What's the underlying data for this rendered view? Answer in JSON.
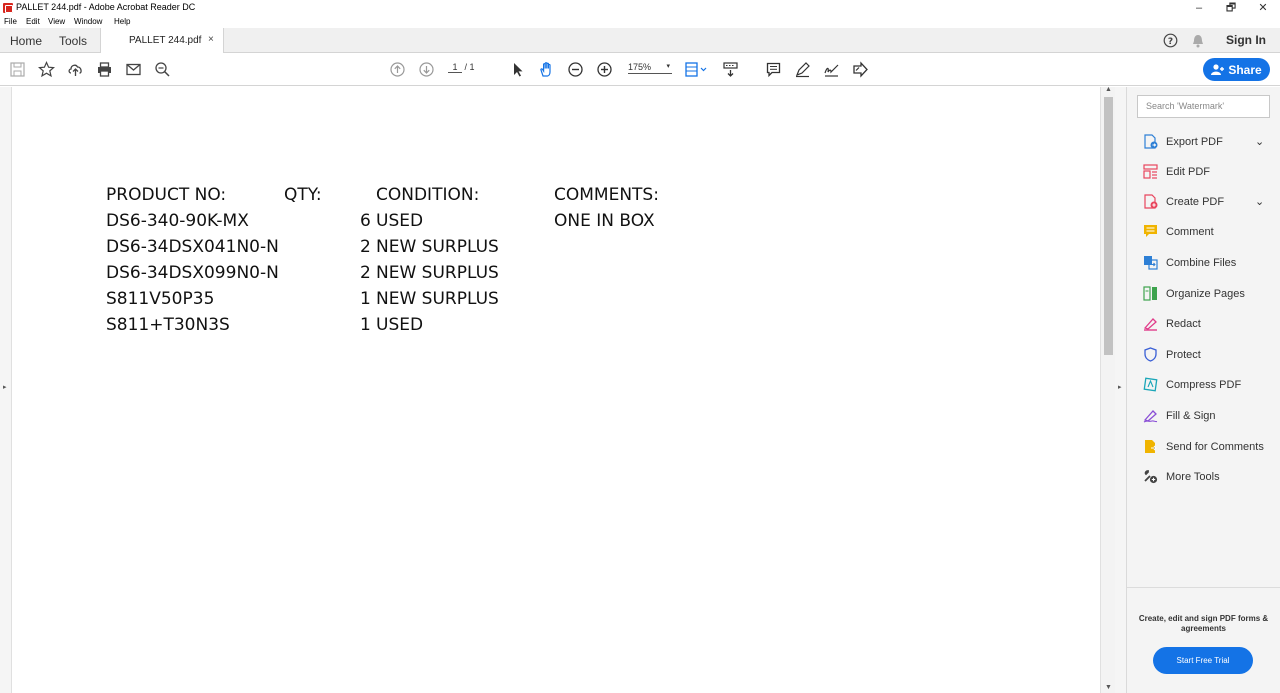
{
  "window": {
    "title": "PALLET 244.pdf - Adobe Acrobat Reader DC",
    "minimize": "–",
    "maximize": "🗗",
    "close": "✕"
  },
  "menu": [
    "File",
    "Edit",
    "View",
    "Window",
    "Help"
  ],
  "tabs": {
    "home": "Home",
    "tools": "Tools",
    "document": "PALLET 244.pdf",
    "close": "×"
  },
  "topright": {
    "help": "?",
    "sign_in": "Sign In"
  },
  "toolbar": {
    "page_current": "1",
    "page_total": "/ 1",
    "zoom": "175%",
    "zoom_caret": "▾",
    "share_label": "Share"
  },
  "document": {
    "headers": [
      "PRODUCT NO:",
      "QTY:",
      "CONDITION:",
      "COMMENTS:"
    ],
    "rows": [
      {
        "product": "DS6-340-90K-MX",
        "qty": "6",
        "condition": "USED",
        "comment": "ONE IN BOX"
      },
      {
        "product": "DS6-34DSX041N0-N",
        "qty": "2",
        "condition": "NEW SURPLUS",
        "comment": ""
      },
      {
        "product": "DS6-34DSX099N0-N",
        "qty": "2",
        "condition": "NEW SURPLUS",
        "comment": ""
      },
      {
        "product": "S811V50P35",
        "qty": "1",
        "condition": "NEW SURPLUS",
        "comment": ""
      },
      {
        "product": "S811+T30N3S",
        "qty": "1",
        "condition": "USED",
        "comment": ""
      }
    ]
  },
  "right_panel": {
    "search_placeholder": "Search 'Watermark'",
    "tools": [
      {
        "label": "Export PDF",
        "icon": "export-pdf-icon",
        "color": "#2d7fd5",
        "expandable": true
      },
      {
        "label": "Edit PDF",
        "icon": "edit-pdf-icon",
        "color": "#e8455d",
        "expandable": false
      },
      {
        "label": "Create PDF",
        "icon": "create-pdf-icon",
        "color": "#e8455d",
        "expandable": true
      },
      {
        "label": "Comment",
        "icon": "comment-icon",
        "color": "#f0b400",
        "expandable": false
      },
      {
        "label": "Combine Files",
        "icon": "combine-files-icon",
        "color": "#2d7fd5",
        "expandable": false
      },
      {
        "label": "Organize Pages",
        "icon": "organize-pages-icon",
        "color": "#3da34d",
        "expandable": false
      },
      {
        "label": "Redact",
        "icon": "redact-icon",
        "color": "#e03c8a",
        "expandable": false
      },
      {
        "label": "Protect",
        "icon": "protect-icon",
        "color": "#3b60d6",
        "expandable": false
      },
      {
        "label": "Compress PDF",
        "icon": "compress-pdf-icon",
        "color": "#1aa6b8",
        "expandable": false
      },
      {
        "label": "Fill & Sign",
        "icon": "fill-sign-icon",
        "color": "#8a4fd6",
        "expandable": false
      },
      {
        "label": "Send for Comments",
        "icon": "send-for-comments-icon",
        "color": "#f0b400",
        "expandable": false
      },
      {
        "label": "More Tools",
        "icon": "more-tools-icon",
        "color": "#444444",
        "expandable": false
      }
    ],
    "chevron": "⌄",
    "promo_text": "Create, edit and sign PDF forms & agreements",
    "promo_button": "Start Free Trial"
  }
}
